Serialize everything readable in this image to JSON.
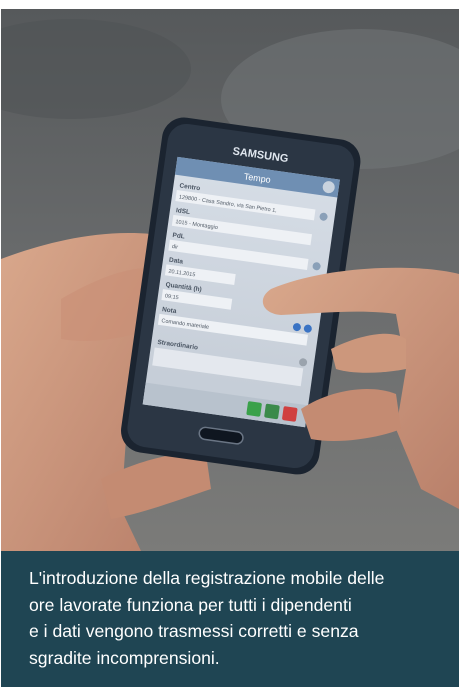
{
  "photo": {
    "phone_brand": "SAMSUNG",
    "app": {
      "title": "Tempo",
      "fields": [
        {
          "label": "Centro",
          "value": "129800 - Casa Sandro, via San Pietro 1,"
        },
        {
          "label": "IdSL",
          "value": "1015 - Montaggio"
        },
        {
          "label": "PdL",
          "value": "dir"
        },
        {
          "label": "Data",
          "value": "20.11.2015"
        },
        {
          "label": "Quantità (h)",
          "value": "09:15"
        },
        {
          "label": "Nota",
          "value": "Comando materiale"
        },
        {
          "label": "Straordinario",
          "value": ""
        }
      ]
    }
  },
  "caption": {
    "lines": [
      "L'introduzione della registrazione mobile delle",
      "ore lavorate funziona per tutti i dipendenti",
      "e i dati vengono trasmessi corretti e senza",
      "sgradite incomprensioni."
    ]
  },
  "colors": {
    "caption_background": "#1f4553",
    "caption_text": "#ffffff",
    "app_header": "#6f8fb3"
  }
}
